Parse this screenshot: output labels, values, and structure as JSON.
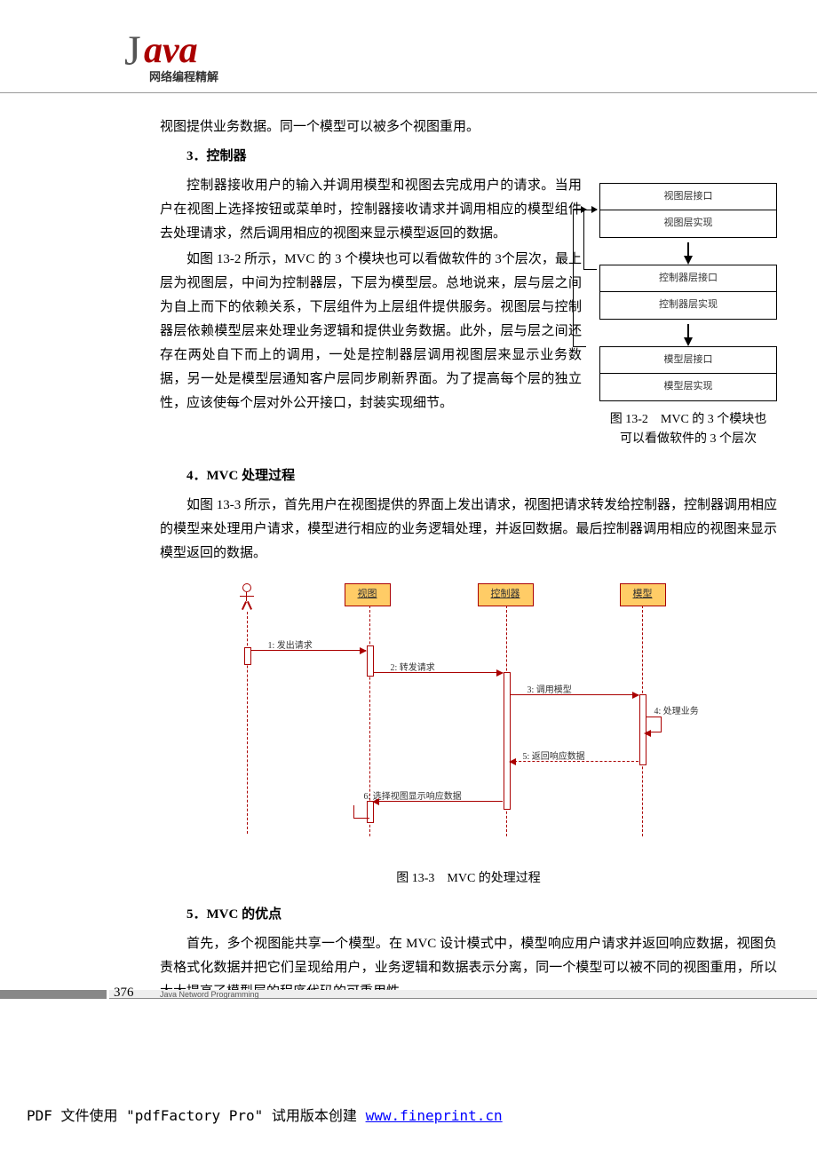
{
  "logo": {
    "j": "J",
    "ava": "ava",
    "sub": "网络编程精解"
  },
  "p1": "视图提供业务数据。同一个模型可以被多个视图重用。",
  "h3": "3．控制器",
  "p2": "控制器接收用户的输入并调用模型和视图去完成用户的请求。当用户在视图上选择按钮或菜单时，控制器接收请求并调用相应的模型组件去处理请求，然后调用相应的视图来显示模型返回的数据。",
  "p3": "如图 13-2 所示，MVC 的 3 个模块也可以看做软件的 3个层次，最上层为视图层，中间为控制器层，下层为模型层。总地说来，层与层之间为自上而下的依赖关系，下层组件为上层组件提供服务。视图层与控制器层依赖模型层来处理业务逻辑和提供业务数据。此外，层与层之间还存在两处自下而上的调用，一处是控制器层调用视图层来显示业务数据，另一处是模型层通知客户层同步刷新界面。为了提高每个层的独立性，应该使每个层对外公开接口，封装实现细节。",
  "fig2": {
    "l1": "视图层接口",
    "l2": "视图层实现",
    "l3": "控制器层接口",
    "l4": "控制器层实现",
    "l5": "模型层接口",
    "l6": "模型层实现",
    "caption_a": "图 13-2　MVC 的 3 个模块也",
    "caption_b": "可以看做软件的 3 个层次"
  },
  "h4": "4．MVC 处理过程",
  "p4": "如图 13-3 所示，首先用户在视图提供的界面上发出请求，视图把请求转发给控制器，控制器调用相应的模型来处理用户请求，模型进行相应的业务逻辑处理，并返回数据。最后控制器调用相应的视图来显示模型返回的数据。",
  "seq": {
    "a1": "视图",
    "a2": "控制器",
    "a3": "模型",
    "m1": "1: 发出请求",
    "m2": "2: 转发请求",
    "m3": "3: 调用模型",
    "m4": "4: 处理业务",
    "m5": "5: 返回响应数据",
    "m6": "6: 选择视图显示响应数据"
  },
  "fig3_caption": "图 13-3　MVC 的处理过程",
  "h5": "5．MVC 的优点",
  "p5": "首先，多个视图能共享一个模型。在 MVC 设计模式中，模型响应用户请求并返回响应数据，视图负责格式化数据并把它们呈现给用户，业务逻辑和数据表示分离，同一个模型可以被不同的视图重用，所以大大提高了模型层的程序代码的可重用性。",
  "page_num": "376",
  "footer_text": "Java Netword Programming",
  "pdf_pre": "PDF 文件使用 \"pdfFactory Pro\" 试用版本创建 ",
  "pdf_link": "www.fineprint.cn"
}
